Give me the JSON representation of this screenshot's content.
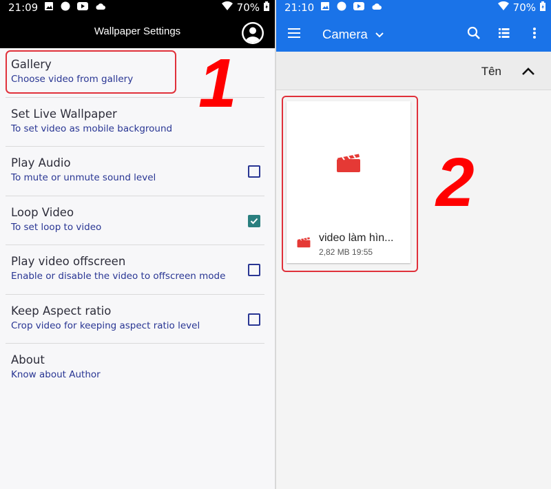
{
  "left": {
    "status": {
      "time": "21:09",
      "battery": "70%"
    },
    "appbar": {
      "title": "Wallpaper Settings"
    },
    "items": [
      {
        "title": "Gallery",
        "subtitle": "Choose video from gallery",
        "checkbox": null
      },
      {
        "title": "Set Live Wallpaper",
        "subtitle": "To set video as mobile background",
        "checkbox": null
      },
      {
        "title": "Play Audio",
        "subtitle": "To mute or unmute sound level",
        "checkbox": false
      },
      {
        "title": "Loop Video",
        "subtitle": "To set loop to video",
        "checkbox": true
      },
      {
        "title": "Play video offscreen",
        "subtitle": "Enable or disable the video to offscreen mode",
        "checkbox": false
      },
      {
        "title": "Keep Aspect ratio",
        "subtitle": "Crop video for keeping aspect ratio level",
        "checkbox": false
      },
      {
        "title": "About",
        "subtitle": "Know about Author",
        "checkbox": null
      }
    ],
    "step_label": "1"
  },
  "right": {
    "status": {
      "time": "21:10",
      "battery": "70%"
    },
    "appbar": {
      "title": "Camera"
    },
    "sort": {
      "label": "Tên"
    },
    "file": {
      "name": "video làm hìn...",
      "meta": "2,82 MB 19:55"
    },
    "step_label": "2"
  },
  "colors": {
    "accent_blue": "#1a73e8",
    "subtitle_blue": "#283593",
    "checkbox_checked": "#2a7f7f",
    "highlight_red": "#e0303a",
    "step_number_red": "#ff0000",
    "video_icon_red": "#e53935"
  },
  "icons": {
    "status": [
      "image-icon",
      "circle-icon",
      "youtube-icon",
      "cloud-icon",
      "wifi-icon",
      "battery-icon"
    ],
    "left_appbar": "account-icon",
    "right_appbar": [
      "menu-icon",
      "chevron-down-icon",
      "search-icon",
      "list-view-icon",
      "more-vert-icon"
    ],
    "sort": "chevron-up-icon",
    "file": "video-clapper-icon"
  }
}
